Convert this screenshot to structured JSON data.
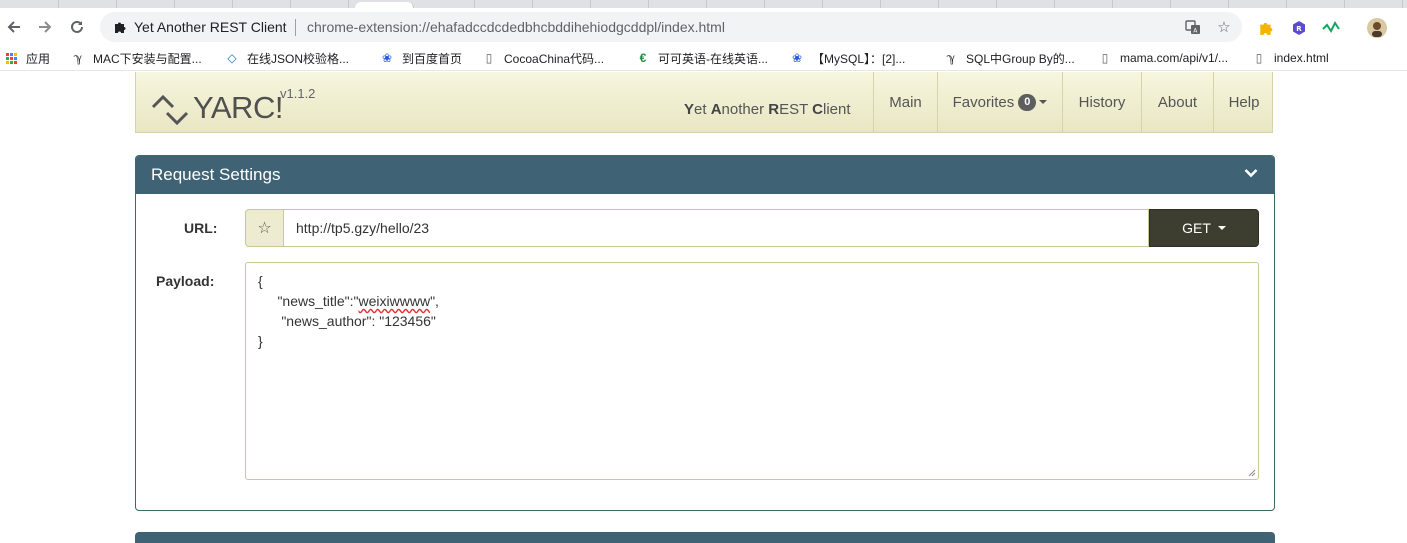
{
  "browser": {
    "tab_title": "Yet Another REST Client",
    "url": "chrome-extension://ehafadccdcdedbhcbddihehiodgcddpl/index.html"
  },
  "bookmarks": [
    {
      "label": "应用",
      "icon": "apps-grid-icon"
    },
    {
      "label": "MAC下安装与配置...",
      "icon": "bookmark-site-icon"
    },
    {
      "label": "在线JSON校验格...",
      "icon": "code-icon"
    },
    {
      "label": "到百度首页",
      "icon": "baidu-paw-icon"
    },
    {
      "label": "CocoaChina代码...",
      "icon": "page-icon"
    },
    {
      "label": "可可英语-在线英语...",
      "icon": "kekenet-icon"
    },
    {
      "label": "【MySQL】：[2]...",
      "icon": "baidu-paw-icon"
    },
    {
      "label": "SQL中Group By的...",
      "icon": "bookmark-site-icon"
    },
    {
      "label": "mama.com/api/v1/...",
      "icon": "page-icon"
    },
    {
      "label": "index.html",
      "icon": "page-icon"
    }
  ],
  "app": {
    "logo": "YARC!",
    "version": "v1.1.2",
    "tagline": {
      "y": "Y",
      "et": "et ",
      "a": "A",
      "nother": "nother ",
      "r": "R",
      "est": "EST ",
      "c": "C",
      "lient": "lient"
    },
    "nav": {
      "main": "Main",
      "favorites": "Favorites",
      "favorites_count": "0",
      "history": "History",
      "about": "About",
      "help": "Help"
    }
  },
  "request": {
    "panel_title": "Request Settings",
    "url_label": "URL:",
    "url_value": "http://tp5.gzy/hello/23",
    "method": "GET",
    "payload_label": "Payload:",
    "payload": {
      "line1": "{",
      "line2_pre": "     \"news_title\":\"",
      "line2_word": "weixiwwww",
      "line2_post": "\",",
      "line3": "      \"news_author\": \"123456\"",
      "line4": "}"
    }
  },
  "colors": {
    "header_bg": "#f1f0d6",
    "panel_heading": "#3f6374",
    "method_button": "#3e3e30"
  }
}
